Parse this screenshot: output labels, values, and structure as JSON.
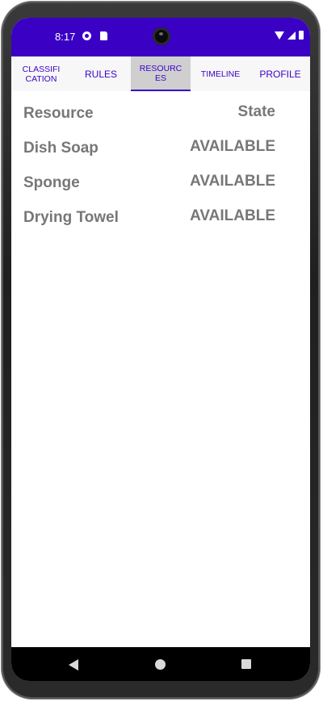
{
  "status_bar": {
    "time": "8:17",
    "background_color": "#3a00c4",
    "icons": [
      "app-notification-icon",
      "sd-card-icon",
      "wifi-icon",
      "signal-icon",
      "battery-icon"
    ]
  },
  "tabs": [
    {
      "label": "CLASSIFI\nCATION",
      "selected": false
    },
    {
      "label": "RULES",
      "selected": false
    },
    {
      "label": "RESOURC\nES",
      "selected": true
    },
    {
      "label": "TIMELINE",
      "selected": false
    },
    {
      "label": "PROFILE",
      "selected": false
    }
  ],
  "tab_accent_color": "#3b00c8",
  "table": {
    "header": {
      "left": "Resource",
      "right": "State"
    },
    "rows": [
      {
        "resource": "Dish Soap",
        "state": "AVAILABLE"
      },
      {
        "resource": "Sponge",
        "state": "AVAILABLE"
      },
      {
        "resource": "Drying Towel",
        "state": "AVAILABLE"
      }
    ]
  },
  "nav_bar": {
    "icons": [
      "back-icon",
      "home-icon",
      "recents-icon"
    ]
  }
}
